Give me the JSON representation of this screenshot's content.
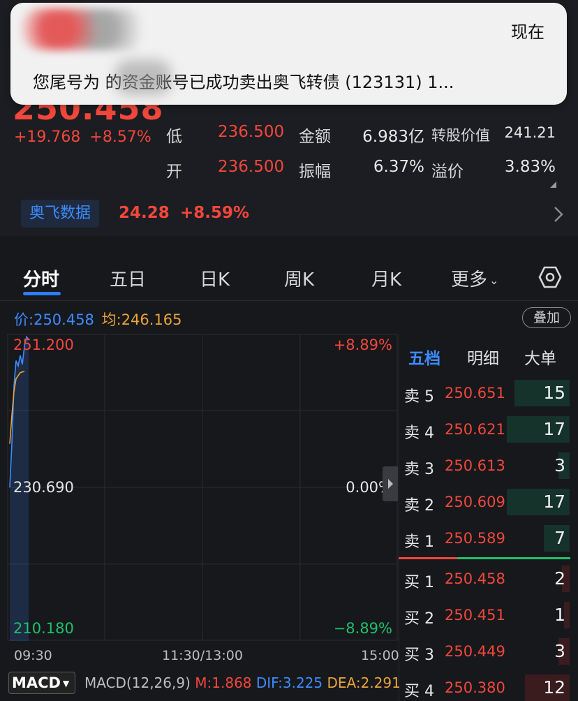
{
  "notification": {
    "time": "现在",
    "message": "您尾号为      的资金账号已成功卖出奥飞转债 (123131) 1..."
  },
  "quote": {
    "price": "250.458",
    "change": "+19.768",
    "change_pct": "+8.57%",
    "rows": [
      {
        "label": "低",
        "value": "236.500",
        "label2": "金额",
        "value2": "6.983亿",
        "label3": "转股价值",
        "value3": "241.21"
      },
      {
        "label": "开",
        "value": "236.500",
        "label2": "振幅",
        "value2": "6.37%",
        "label3": "溢价",
        "value3": "3.83%"
      }
    ]
  },
  "stock_link": {
    "name": "奥飞数据",
    "price": "24.28",
    "change_pct": "+8.59%"
  },
  "tabs": [
    "分时",
    "五日",
    "日K",
    "周K",
    "月K",
    "更多"
  ],
  "price_bar": {
    "price_label": "价:",
    "price": "250.458",
    "avg_label": "均:",
    "avg": "246.165",
    "overlay_button": "叠加"
  },
  "chart_data": {
    "type": "line",
    "y_labels": {
      "top": "251.200",
      "mid": "230.690",
      "bottom": "210.180"
    },
    "pct_labels": {
      "top": "+8.89%",
      "mid": "0.00%",
      "bottom": "−8.89%"
    },
    "x_ticks": [
      "09:30",
      "11:30/13:00",
      "15:00"
    ],
    "ylim": [
      210.18,
      251.2
    ],
    "series": [
      {
        "color": "#3d8bff",
        "values": [
          230.69,
          236.5,
          244.2,
          247.6,
          246.9,
          248.3,
          247.1,
          249.5,
          250.8,
          250.458
        ]
      },
      {
        "color": "#e8a33a",
        "values": [
          236.5,
          240.3,
          243.5,
          245.2,
          245.6,
          246.0,
          246.1,
          246.165
        ]
      }
    ]
  },
  "order_book": {
    "tabs": [
      "五档",
      "明细",
      "大单"
    ],
    "asks": [
      {
        "label": "卖 5",
        "price": "250.651",
        "qty": "15",
        "qty_num": 15
      },
      {
        "label": "卖 4",
        "price": "250.621",
        "qty": "17",
        "qty_num": 17
      },
      {
        "label": "卖 3",
        "price": "250.613",
        "qty": "3",
        "qty_num": 3
      },
      {
        "label": "卖 2",
        "price": "250.609",
        "qty": "17",
        "qty_num": 17
      },
      {
        "label": "卖 1",
        "price": "250.589",
        "qty": "7",
        "qty_num": 7
      }
    ],
    "bids": [
      {
        "label": "买 1",
        "price": "250.458",
        "qty": "2",
        "qty_num": 2
      },
      {
        "label": "买 2",
        "price": "250.451",
        "qty": "1",
        "qty_num": 1
      },
      {
        "label": "买 3",
        "price": "250.449",
        "qty": "3",
        "qty_num": 3
      },
      {
        "label": "买 4",
        "price": "250.380",
        "qty": "12",
        "qty_num": 12
      }
    ]
  },
  "macd": {
    "indicator": "MACD",
    "params": "MACD(12,26,9)",
    "m": "M:1.868",
    "dif": "DIF:3.225",
    "dea": "DEA:2.291"
  }
}
